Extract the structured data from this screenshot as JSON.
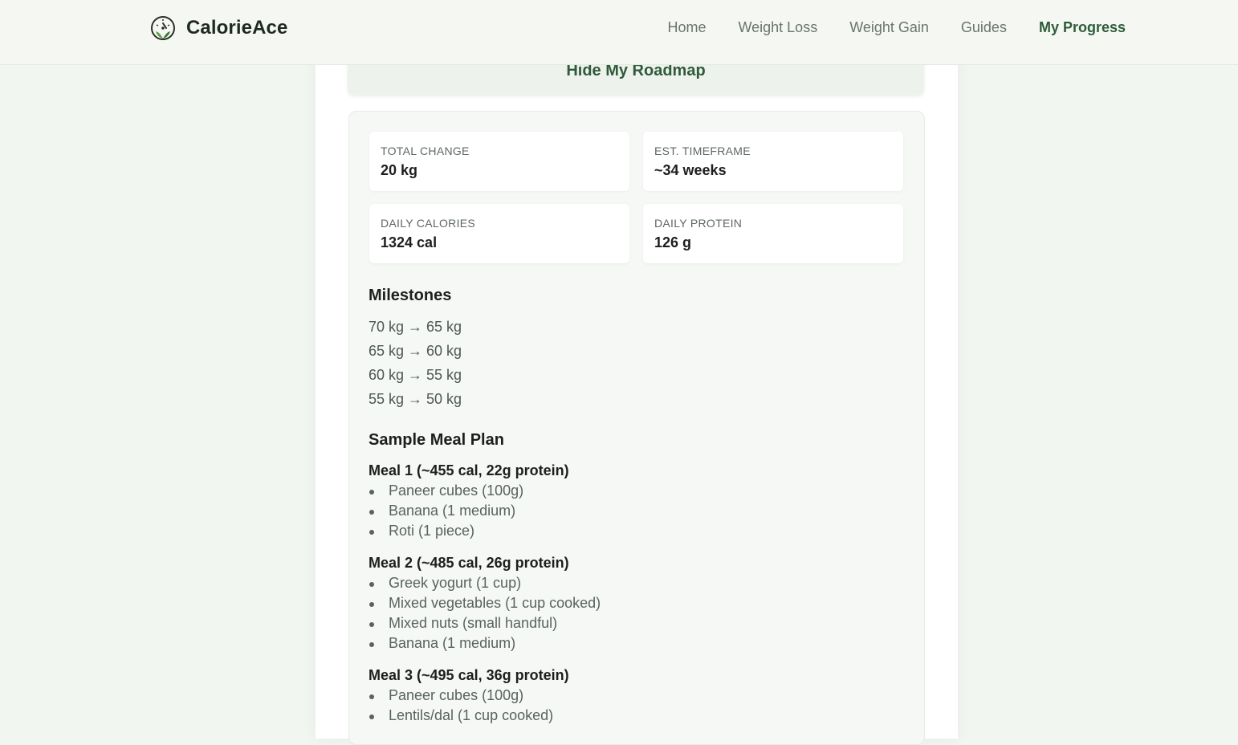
{
  "brand": {
    "name": "CalorieAce"
  },
  "nav": {
    "items": [
      {
        "label": "Home"
      },
      {
        "label": "Weight Loss"
      },
      {
        "label": "Weight Gain"
      },
      {
        "label": "Guides"
      },
      {
        "label": "My Progress",
        "active": true
      }
    ]
  },
  "roadmap_toggle": {
    "label": "Hide My Roadmap"
  },
  "stats": [
    {
      "label": "TOTAL CHANGE",
      "value": "20 kg"
    },
    {
      "label": "EST. TIMEFRAME",
      "value": "~34 weeks"
    },
    {
      "label": "DAILY CALORIES",
      "value": "1324 cal"
    },
    {
      "label": "DAILY PROTEIN",
      "value": "126 g"
    }
  ],
  "milestones": {
    "title": "Milestones",
    "items": [
      "70 kg → 65 kg",
      "65 kg → 60 kg",
      "60 kg → 55 kg",
      "55 kg → 50 kg"
    ]
  },
  "meal_plan": {
    "title": "Sample Meal Plan",
    "meals": [
      {
        "title": "Meal 1 (~455 cal, 22g protein)",
        "items": [
          "Paneer cubes (100g)",
          "Banana (1 medium)",
          "Roti (1 piece)"
        ]
      },
      {
        "title": "Meal 2 (~485 cal, 26g protein)",
        "items": [
          "Greek yogurt (1 cup)",
          "Mixed vegetables (1 cup cooked)",
          "Mixed nuts (small handful)",
          "Banana (1 medium)"
        ]
      },
      {
        "title": "Meal 3 (~495 cal, 36g protein)",
        "items": [
          "Paneer cubes (100g)",
          "Lentils/dal (1 cup cooked)"
        ]
      }
    ]
  },
  "colors": {
    "accent": "#2e5c3a",
    "background": "#f2f6f1",
    "panel": "#f5f8f4"
  }
}
